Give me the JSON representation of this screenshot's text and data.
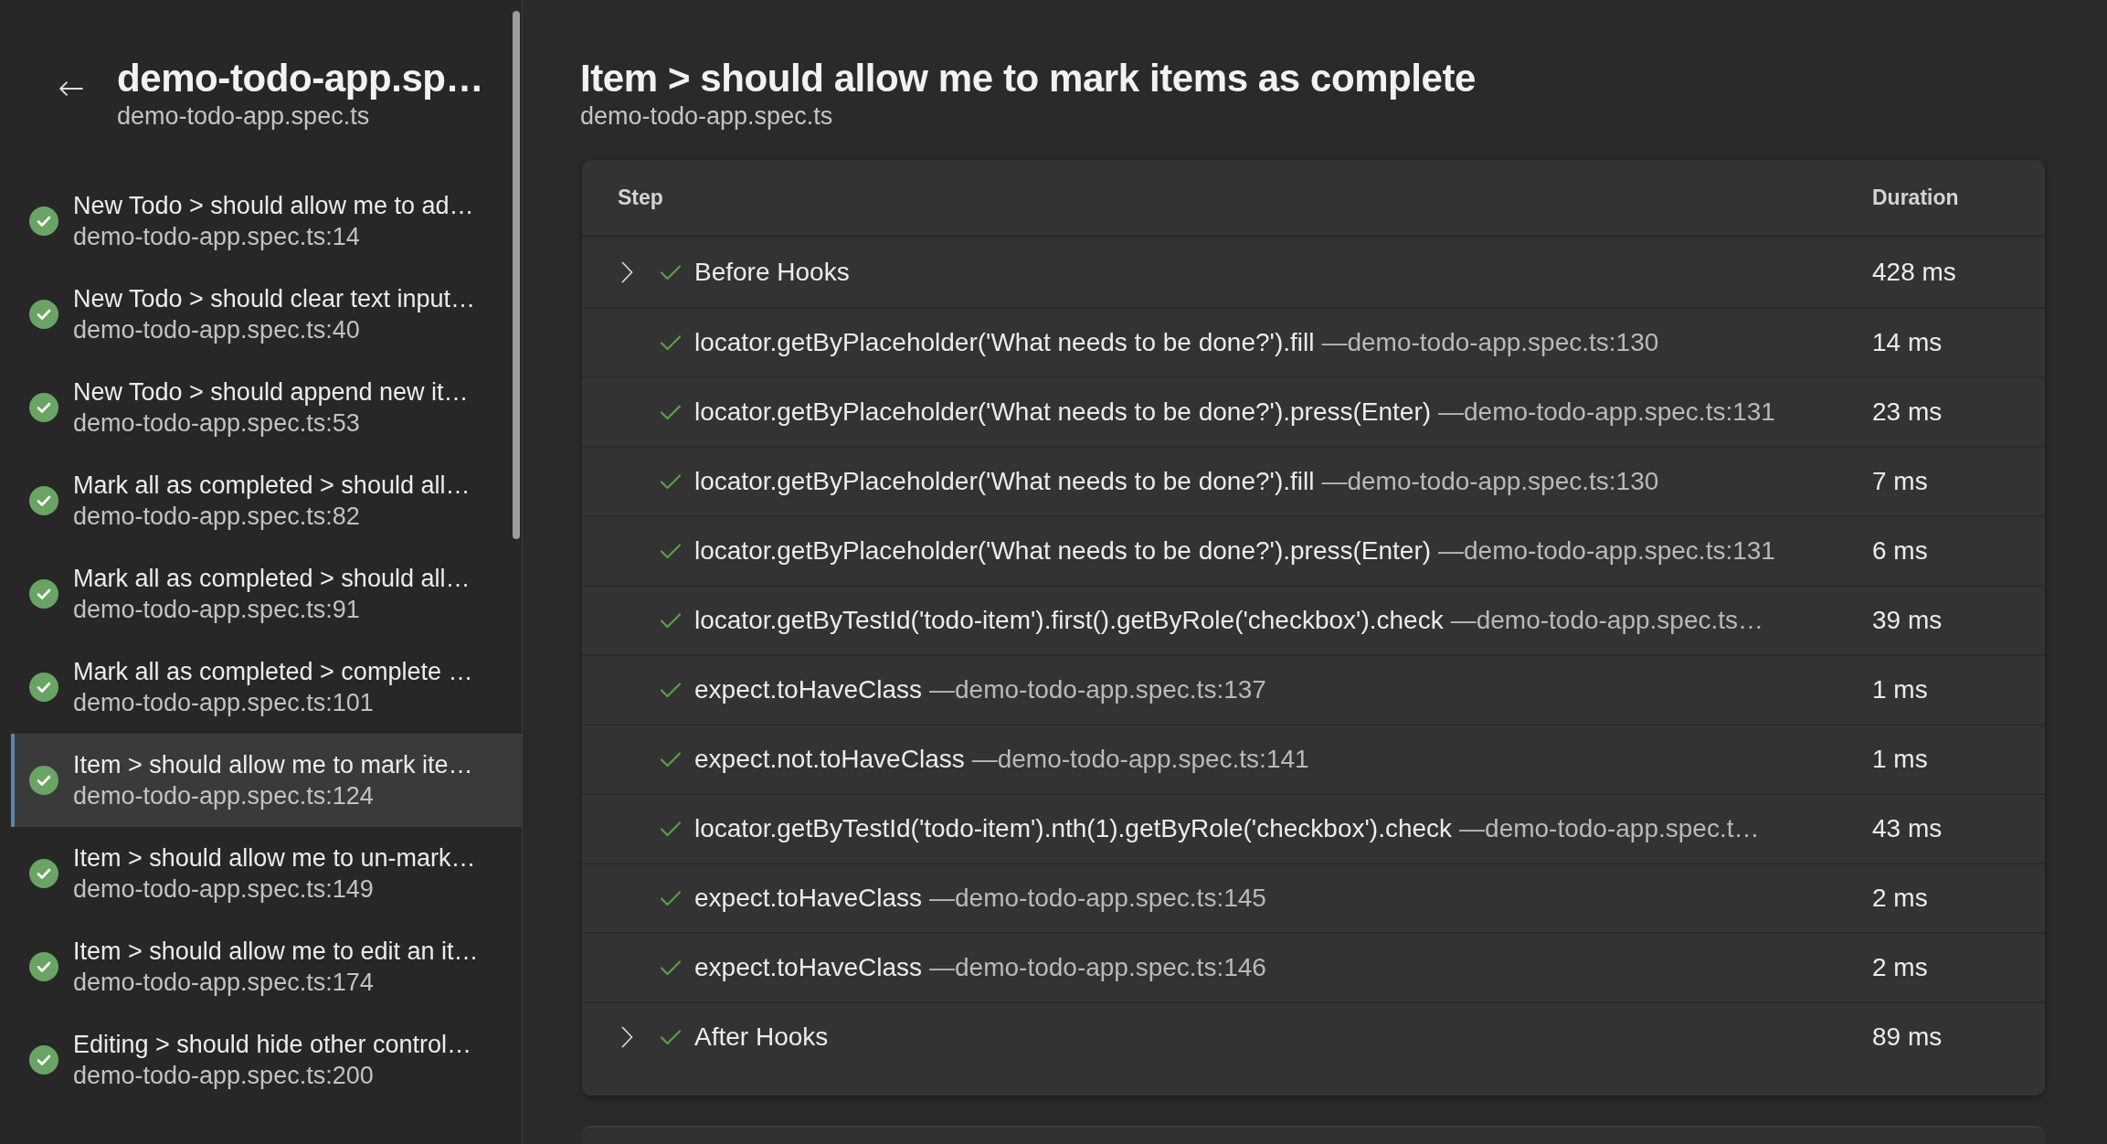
{
  "sidebar": {
    "title": "demo-todo-app.sp…",
    "subtitle": "demo-todo-app.spec.ts",
    "tests": [
      {
        "title": "New Todo > should allow me to ad…",
        "location": "demo-todo-app.spec.ts:14",
        "passed": true,
        "selected": false
      },
      {
        "title": "New Todo > should clear text input…",
        "location": "demo-todo-app.spec.ts:40",
        "passed": true,
        "selected": false
      },
      {
        "title": "New Todo > should append new it…",
        "location": "demo-todo-app.spec.ts:53",
        "passed": true,
        "selected": false
      },
      {
        "title": "Mark all as completed > should all…",
        "location": "demo-todo-app.spec.ts:82",
        "passed": true,
        "selected": false
      },
      {
        "title": "Mark all as completed > should all…",
        "location": "demo-todo-app.spec.ts:91",
        "passed": true,
        "selected": false
      },
      {
        "title": "Mark all as completed > complete …",
        "location": "demo-todo-app.spec.ts:101",
        "passed": true,
        "selected": false
      },
      {
        "title": "Item > should allow me to mark ite…",
        "location": "demo-todo-app.spec.ts:124",
        "passed": true,
        "selected": true
      },
      {
        "title": "Item > should allow me to un-mark…",
        "location": "demo-todo-app.spec.ts:149",
        "passed": true,
        "selected": false
      },
      {
        "title": "Item > should allow me to edit an it…",
        "location": "demo-todo-app.spec.ts:174",
        "passed": true,
        "selected": false
      },
      {
        "title": "Editing > should hide other control…",
        "location": "demo-todo-app.spec.ts:200",
        "passed": true,
        "selected": false
      }
    ]
  },
  "main": {
    "title": "Item > should allow me to mark items as complete",
    "subtitle": "demo-todo-app.spec.ts",
    "steps_table": {
      "columns": [
        "Step",
        "Duration"
      ],
      "rows": [
        {
          "kind": "group",
          "expanded": false,
          "passed": true,
          "title": "Before Hooks",
          "duration": "428 ms"
        },
        {
          "kind": "step",
          "passed": true,
          "title": "locator.getByPlaceholder('What needs to be done?').fill",
          "location": "—demo-todo-app.spec.ts:130",
          "duration": "14 ms"
        },
        {
          "kind": "step",
          "passed": true,
          "title": "locator.getByPlaceholder('What needs to be done?').press(Enter)",
          "location": "—demo-todo-app.spec.ts:131",
          "duration": "23 ms"
        },
        {
          "kind": "step",
          "passed": true,
          "title": "locator.getByPlaceholder('What needs to be done?').fill",
          "location": "—demo-todo-app.spec.ts:130",
          "duration": "7 ms"
        },
        {
          "kind": "step",
          "passed": true,
          "title": "locator.getByPlaceholder('What needs to be done?').press(Enter)",
          "location": "—demo-todo-app.spec.ts:131",
          "duration": "6 ms"
        },
        {
          "kind": "step",
          "passed": true,
          "title": "locator.getByTestId('todo-item').first().getByRole('checkbox').check",
          "location": "—demo-todo-app.spec.ts…",
          "duration": "39 ms"
        },
        {
          "kind": "step",
          "passed": true,
          "title": "expect.toHaveClass",
          "location": "—demo-todo-app.spec.ts:137",
          "duration": "1 ms"
        },
        {
          "kind": "step",
          "passed": true,
          "title": "expect.not.toHaveClass",
          "location": "—demo-todo-app.spec.ts:141",
          "duration": "1 ms"
        },
        {
          "kind": "step",
          "passed": true,
          "title": "locator.getByTestId('todo-item').nth(1).getByRole('checkbox').check",
          "location": "—demo-todo-app.spec.t…",
          "duration": "43 ms"
        },
        {
          "kind": "step",
          "passed": true,
          "title": "expect.toHaveClass",
          "location": "—demo-todo-app.spec.ts:145",
          "duration": "2 ms"
        },
        {
          "kind": "step",
          "passed": true,
          "title": "expect.toHaveClass",
          "location": "—demo-todo-app.spec.ts:146",
          "duration": "2 ms"
        },
        {
          "kind": "group",
          "expanded": false,
          "passed": true,
          "title": "After Hooks",
          "duration": "89 ms"
        }
      ]
    }
  }
}
